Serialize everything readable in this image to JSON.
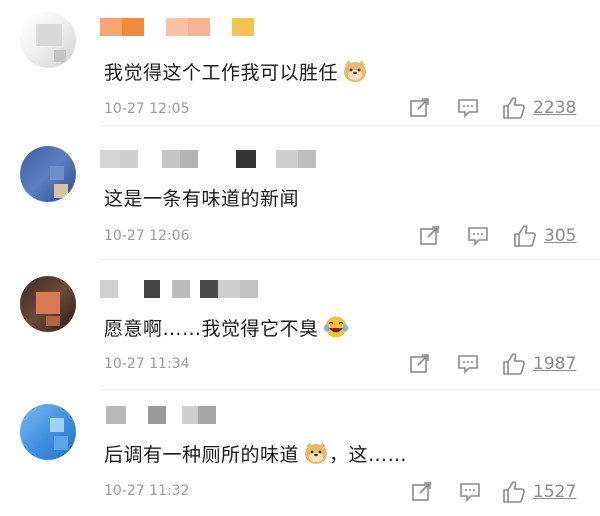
{
  "comments": [
    {
      "text": "我觉得这个工作我可以胜任",
      "emoji": "doge-emoji",
      "time": "10-27 12:05",
      "likes": "2238"
    },
    {
      "text": "这是一条有味道的新闻",
      "emoji": "",
      "time": "10-27 12:06",
      "likes": "305"
    },
    {
      "text": "愿意啊……我觉得它不臭",
      "emoji": "laughing-tears-emoji",
      "time": "10-27 11:34",
      "likes": "1987"
    },
    {
      "text": "后调有一种厕所的味道",
      "text_suffix": "，这……",
      "emoji": "doge-emoji",
      "time": "10-27 11:32",
      "likes": "1527"
    }
  ],
  "icons": [
    "share-icon",
    "comment-icon",
    "like-icon"
  ],
  "colors": {
    "like_count": "#8a8a8a",
    "meta": "#9a9a9a",
    "divider": "#ececec",
    "name_mosaic_orange": "#f39a5b"
  }
}
